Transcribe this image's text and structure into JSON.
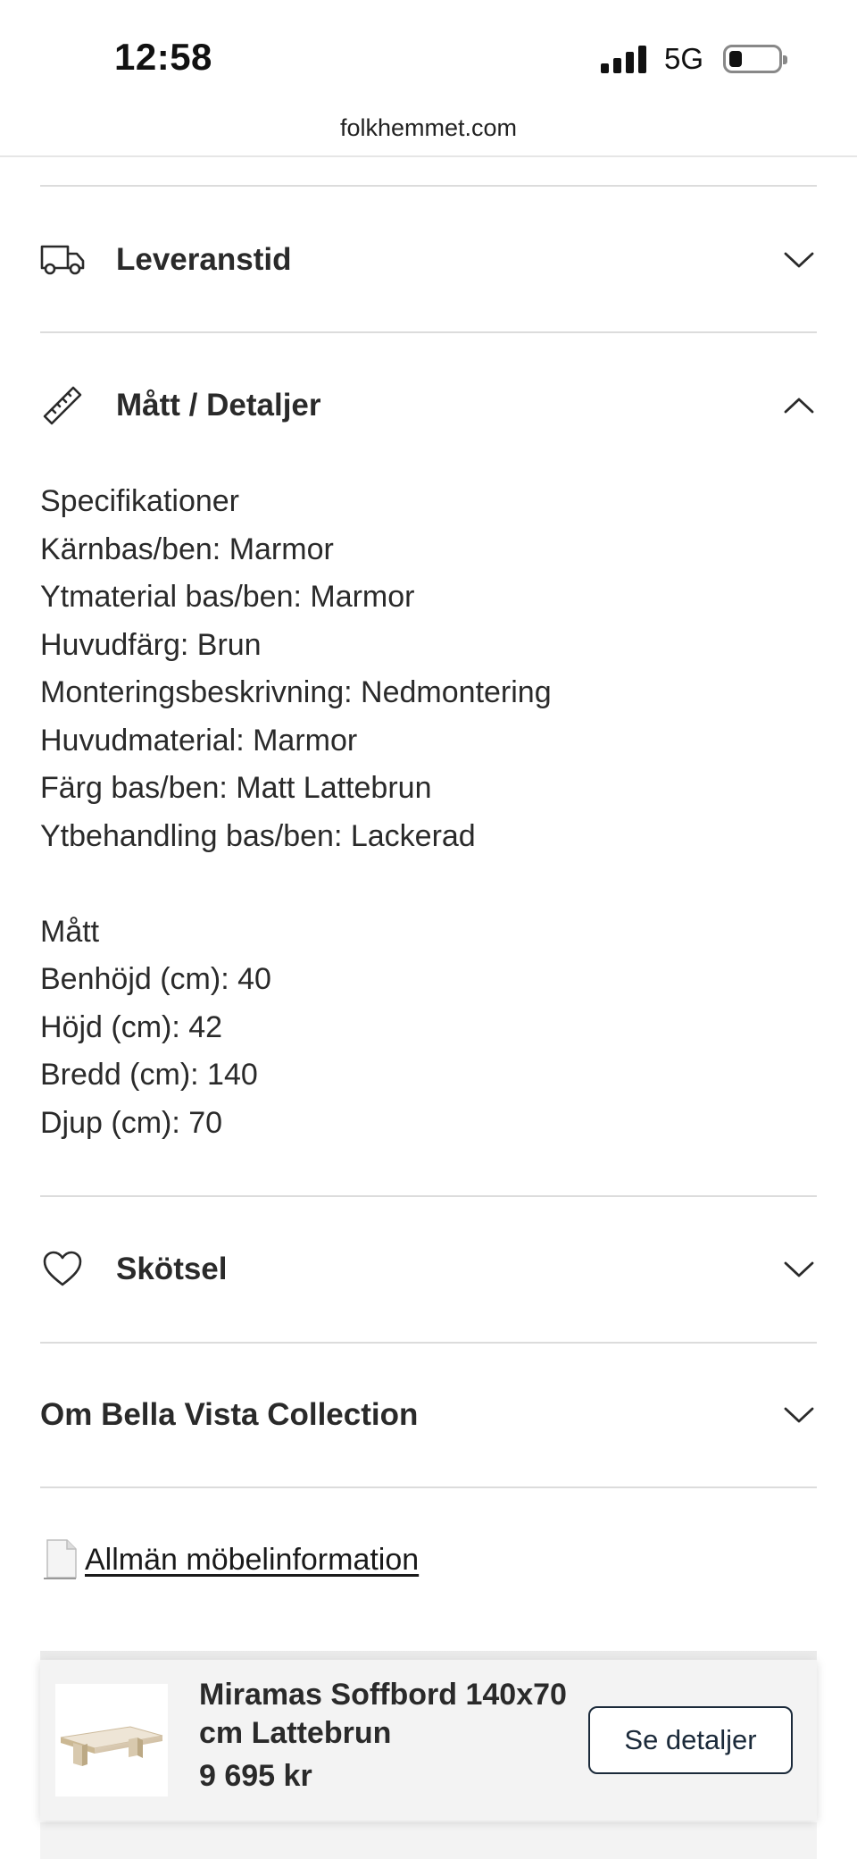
{
  "status_bar": {
    "time": "12:58",
    "network": "5G"
  },
  "browser": {
    "url": "folkhemmet.com"
  },
  "accordion": {
    "delivery": {
      "title": "Leveranstid",
      "icon": "truck-icon",
      "state": "collapsed"
    },
    "dimensions": {
      "title": "Mått / Detaljer",
      "icon": "ruler-icon",
      "state": "expanded"
    },
    "care": {
      "title": "Skötsel",
      "icon": "heart-icon",
      "state": "collapsed"
    },
    "about": {
      "title": "Om Bella Vista Collection",
      "state": "collapsed"
    }
  },
  "details": {
    "spec_heading": "Specifikationer",
    "specs": [
      "Kärnbas/ben: Marmor",
      "Ytmaterial bas/ben: Marmor",
      "Huvudfärg: Brun",
      "Monteringsbeskrivning: Nedmontering",
      "Huvudmaterial: Marmor",
      "Färg bas/ben: Matt Lattebrun",
      "Ytbehandling bas/ben: Lackerad"
    ],
    "dims_heading": "Mått",
    "dims": [
      "Benhöjd (cm): 40",
      "Höjd (cm): 42",
      "Bredd (cm): 140",
      "Djup (cm): 70"
    ]
  },
  "info_link": {
    "label": "Allmän möbelinformation",
    "icon": "document-icon"
  },
  "sticky_bar": {
    "product_name": "Miramas Soffbord 140x70 cm Lattebrun",
    "price": "9 695 kr",
    "button_label": "Se detaljer"
  },
  "colors": {
    "accent": "#1b2a3a",
    "divider": "#dcdcdc",
    "sticky_bg": "#f3f3f3"
  }
}
